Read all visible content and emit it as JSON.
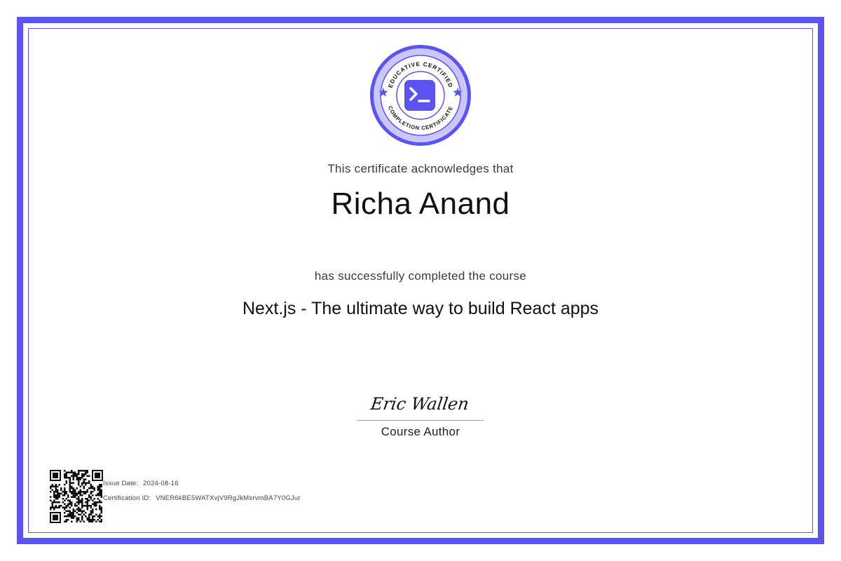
{
  "colors": {
    "accent": "#5a55f2",
    "seal_light": "#c9c7fb",
    "text_primary": "#111111",
    "text_muted": "#3a3a3a"
  },
  "seal": {
    "top_text": "EDUCATIVE CERTIFIED",
    "bottom_text": "COMPLETION CERTIFICATE",
    "icon": "terminal-icon"
  },
  "certificate": {
    "acknowledge_text": "This certificate acknowledges that",
    "recipient_name": "Richa Anand",
    "completed_text": "has successfully completed the course",
    "course_title": "Next.js - The ultimate way to build React apps"
  },
  "signature": {
    "name": "Eric Wallen",
    "role": "Course Author"
  },
  "footer": {
    "issue_label": "Issue Date:",
    "issue_date": "2024-08-16",
    "cert_label": "Certification ID:",
    "cert_id": "VNER6kBE5WATXvjV9RgJkMsrvmBA7Y0GJur",
    "qr_icon": "qr-code-icon"
  }
}
